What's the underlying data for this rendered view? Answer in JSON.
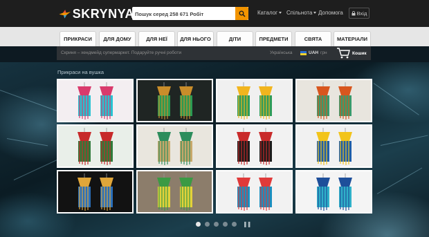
{
  "header": {
    "logo_text": "SKRYNYA",
    "search_placeholder": "Пошук серед 258 671 Робіт",
    "nav": {
      "catalog": "Каталог",
      "community": "Спільнота",
      "help": "Допомога",
      "login": "Вхід"
    }
  },
  "categories": [
    "ПРИКРАСИ",
    "ДЛЯ ДОМУ",
    "ДЛЯ НЕЇ",
    "ДЛЯ НЬОГО",
    "ДІТИ",
    "ПРЕДМЕТИ",
    "СВЯТА",
    "МАТЕРІАЛИ"
  ],
  "infobar": {
    "tagline": "Скриня – хендмейд супермаркет. Подаруйте ручні роботи",
    "language": "Українська",
    "currency_code": "UAH",
    "currency_symbol": "грн",
    "cart_label": "Кошик"
  },
  "hero": {
    "section_title": "Прикраси на вушка",
    "products": [
      {
        "icon": "heart-beaded-earrings",
        "colors": [
          "#f3eef1",
          "#d93a6c",
          "#27c3d2"
        ]
      },
      {
        "icon": "black-gold-beaded-earrings",
        "colors": [
          "#1f2523",
          "#c98d2a",
          "#2b9a52"
        ]
      },
      {
        "icon": "sunflower-beaded-earrings",
        "colors": [
          "#f0f0f0",
          "#f2b51e",
          "#2e9c5a"
        ]
      },
      {
        "icon": "fringe-beaded-earrings",
        "colors": [
          "#e8e5de",
          "#d8561e",
          "#3a9a6b"
        ]
      },
      {
        "icon": "red-roses-beaded-earrings",
        "colors": [
          "#e9efe9",
          "#c72a2a",
          "#2f7a3a"
        ]
      },
      {
        "icon": "green-fringe-earrings",
        "colors": [
          "#e9e6de",
          "#2c8d5c",
          "#c7a86a"
        ]
      },
      {
        "icon": "red-fringe-earrings",
        "colors": [
          "#f2f2f2",
          "#c92b2b",
          "#1c1c1c"
        ]
      },
      {
        "icon": "yellow-blue-earrings",
        "colors": [
          "#f1f1f1",
          "#f2c41b",
          "#1f5ea8"
        ]
      },
      {
        "icon": "gold-fringe-earrings",
        "colors": [
          "#121212",
          "#e0a63a",
          "#2a6fba"
        ]
      },
      {
        "icon": "green-yellow-earrings",
        "colors": [
          "#8c7d6b",
          "#3b9a44",
          "#e4d13a"
        ]
      },
      {
        "icon": "geometric-beaded-earrings",
        "colors": [
          "#f2f2f2",
          "#e03a3a",
          "#1b8fbf"
        ]
      },
      {
        "icon": "blue-gradient-earrings",
        "colors": [
          "#f4f4f4",
          "#1e4f9a",
          "#2fb0c9"
        ]
      }
    ],
    "carousel": {
      "count": 5,
      "active": 0
    }
  }
}
